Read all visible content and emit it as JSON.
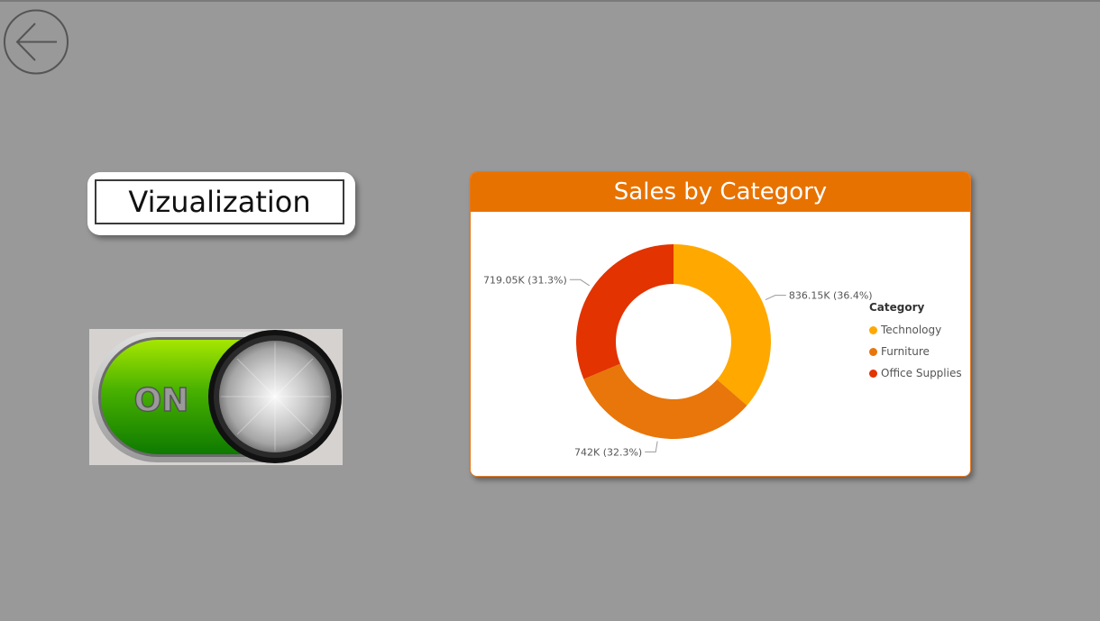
{
  "nav": {
    "back_icon": "arrow-left-circle-icon"
  },
  "title_card": {
    "text": "Vizualization"
  },
  "toggle": {
    "label": "ON",
    "state": "on",
    "icon": "metal-knob-toggle"
  },
  "chart": {
    "header": "Sales by Category"
  },
  "chart_data": {
    "type": "pie",
    "donut": true,
    "title": "Sales by Category",
    "legend_title": "Category",
    "legend_position": "right",
    "categories": [
      "Technology",
      "Furniture",
      "Office Supplies"
    ],
    "values": [
      836.15,
      742,
      719.05
    ],
    "value_unit": "K",
    "labels": [
      "836.15K (36.4%)",
      "742K (32.3%)",
      "719.05K (31.3%)"
    ],
    "colors": [
      "#FFA800",
      "#E8760A",
      "#E23300"
    ]
  }
}
